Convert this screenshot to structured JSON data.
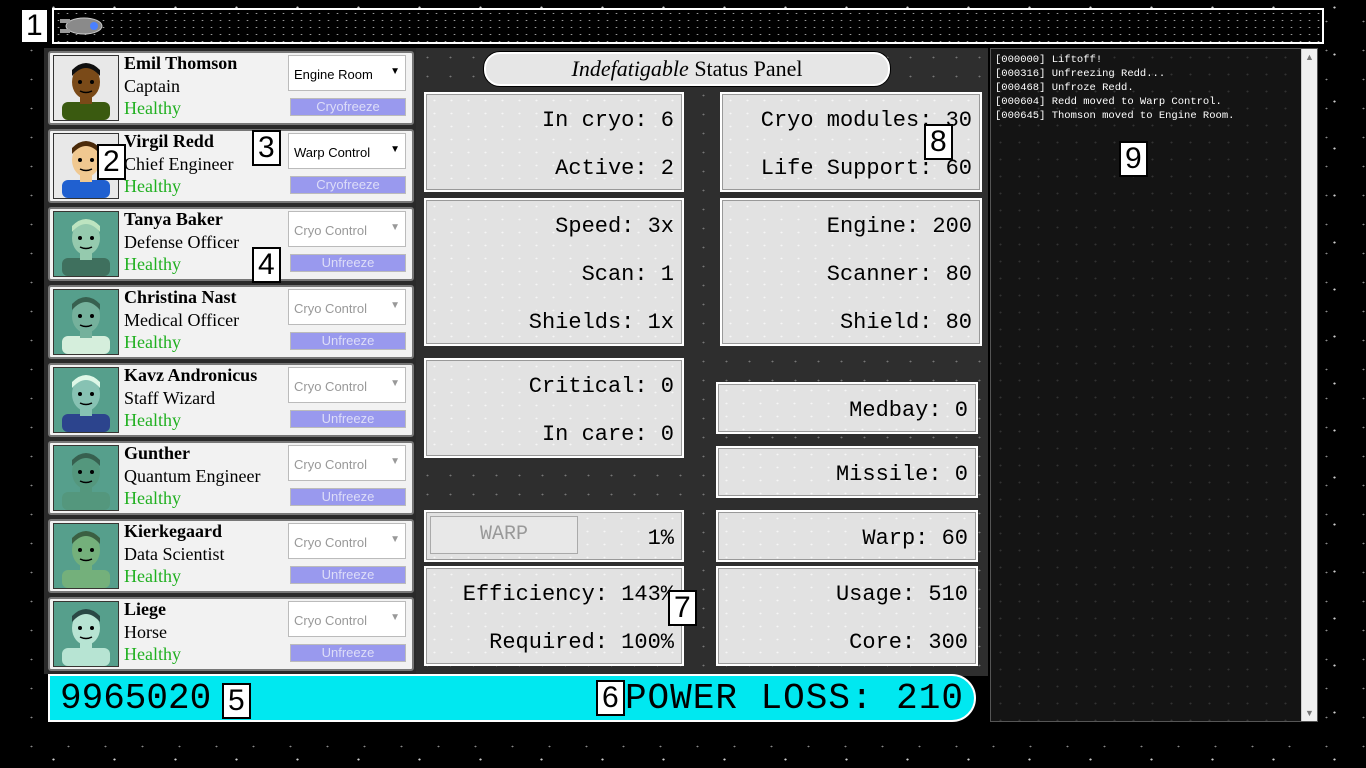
{
  "markers": [
    "1",
    "2",
    "3",
    "4",
    "5",
    "6",
    "7",
    "8",
    "9"
  ],
  "crew": [
    {
      "name": "Emil Thomson",
      "role": "Captain",
      "status": "Healthy",
      "location": "Engine Room",
      "action": "Cryofreeze",
      "frozen": false,
      "skin": "#7a4a18",
      "hair": "#101010",
      "shirt": "#3a5a10"
    },
    {
      "name": "Virgil Redd",
      "role": "Chief Engineer",
      "status": "Healthy",
      "location": "Warp Control",
      "action": "Cryofreeze",
      "frozen": false,
      "skin": "#f0c890",
      "hair": "#4a2a0a",
      "shirt": "#2060d0"
    },
    {
      "name": "Tanya Baker",
      "role": "Defense Officer",
      "status": "Healthy",
      "location": "Cryo Control",
      "action": "Unfreeze",
      "frozen": true,
      "skin": "#7fc8b0",
      "hair": "#a8e0c0",
      "shirt": "#307060"
    },
    {
      "name": "Christina Nast",
      "role": "Medical Officer",
      "status": "Healthy",
      "location": "Cryo Control",
      "action": "Unfreeze",
      "frozen": true,
      "skin": "#60b0a0",
      "hair": "#2a6050",
      "shirt": "#c0e8e0"
    },
    {
      "name": "Kavz Andronicus",
      "role": "Staff Wizard",
      "status": "Healthy",
      "location": "Cryo Control",
      "action": "Unfreeze",
      "frozen": true,
      "skin": "#70c0b8",
      "hair": "#c8f0ec",
      "shirt": "#2040a0"
    },
    {
      "name": "Gunther",
      "role": "Quantum Engineer",
      "status": "Healthy",
      "location": "Cryo Control",
      "action": "Unfreeze",
      "frozen": true,
      "skin": "#409880",
      "hair": "#2a6050",
      "shirt": "#409880"
    },
    {
      "name": "Kierkegaard",
      "role": "Data Scientist",
      "status": "Healthy",
      "location": "Cryo Control",
      "action": "Unfreeze",
      "frozen": true,
      "skin": "#60b078",
      "hair": "#306040",
      "shirt": "#60b078"
    },
    {
      "name": "Liege",
      "role": "Horse",
      "status": "Healthy",
      "location": "Cryo Control",
      "action": "Unfreeze",
      "frozen": true,
      "skin": "#a0e0d8",
      "hair": "#204848",
      "shirt": "#a0e0d8"
    }
  ],
  "panel": {
    "title_italic": "Indefatigable",
    "title_rest": " Status Panel",
    "in_cryo": "In cryo: 6",
    "active": "Active: 2",
    "cryo_modules": "Cryo modules: 30",
    "life_support": "Life Support: 60",
    "speed": "Speed: 3x",
    "scan": "Scan: 1",
    "shields": "Shields: 1x",
    "engine": "Engine: 200",
    "scanner": "Scanner: 80",
    "shield": "Shield: 80",
    "critical": "Critical: 0",
    "in_care": "In care: 0",
    "medbay": "Medbay: 0",
    "missile": "Missile: 0",
    "warp_button": "WARP",
    "warp_progress": "1%",
    "warp": "Warp: 60",
    "efficiency": "Efficiency: 143%",
    "required": "Required: 100%",
    "usage": "Usage: 510",
    "core": "Core: 300"
  },
  "footer": {
    "score": "9965020",
    "power_loss": "POWER LOSS: 210"
  },
  "log": [
    "[000000] Liftoff!",
    "[000316] Unfreezing Redd...",
    "[000468] Unfroze Redd.",
    "[000604] Redd moved to Warp Control.",
    "[000645] Thomson moved to Engine Room."
  ],
  "colors": {
    "status_green": "#20b020",
    "button_purple": "#9999ee",
    "power_bar": "#00e8f0"
  }
}
